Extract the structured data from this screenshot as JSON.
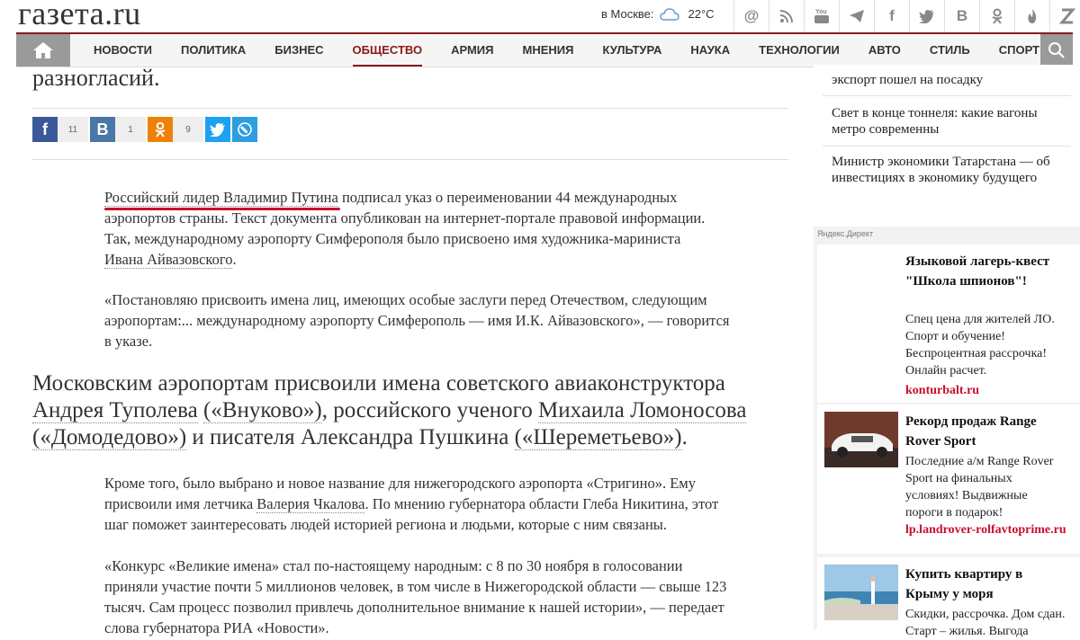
{
  "site": {
    "logo": "газета.ru"
  },
  "weather": {
    "label": "в Москве:",
    "temp": "22°C"
  },
  "social_top": [
    "at-icon",
    "rss-icon",
    "youtube-icon",
    "telegram-icon",
    "facebook-icon",
    "twitter-icon",
    "vk-icon",
    "odnoklassniki-icon",
    "fire-icon",
    "zen-icon"
  ],
  "nav": {
    "items": [
      "НОВОСТИ",
      "ПОЛИТИКА",
      "БИЗНЕС",
      "ОБЩЕСТВО",
      "АРМИЯ",
      "МНЕНИЯ",
      "КУЛЬТУРА",
      "НАУКА",
      "ТЕХНОЛОГИИ",
      "АВТО",
      "СТИЛЬ",
      "СПОРТ"
    ],
    "active": "ОБЩЕСТВО"
  },
  "article": {
    "prev_heading": "разногласий.",
    "share": {
      "fb_count": "11",
      "vk_count": "1",
      "ok_count": "9"
    },
    "p1": {
      "link": "Российский лидер Владимир Путина",
      "line1_rest": " подписал указ о переименовании 44 международных",
      "line2": "аэропортов страны. Текст документа опубликован на интернет-портале правовой информации.",
      "line3": "Так, международному аэропорту Симферополя было присвоено имя художника-мариниста",
      "line4_link": "Ивана Айвазовского",
      "line4_end": "."
    },
    "p2": {
      "line1": "«Постановляю присвоить имена лиц, имеющих особые заслуги перед Отечеством, следующим",
      "line2": "аэропортам:... международному аэропорту Симферополь — имя И.К. Айвазовского», — говорится",
      "line3": "в указе."
    },
    "subhead": {
      "l1": "Московским аэропортам присвоили имена советского авиаконструктора",
      "l2_link1": "Андрея Туполева",
      "l2_mid1": " ",
      "l2_link2": "(«Внуково»)",
      "l2_mid2": ", российского ученого ",
      "l2_link3": "Михаила Ломоносова",
      "l3_link1": "(«Домодедово»)",
      "l3_mid": " и писателя Александра Пушкина ",
      "l3_link2": "(«Шереметьево»)",
      "l3_end": "."
    },
    "p3": {
      "line1": "Кроме того, было выбрано и новое название для нижегородского аэропорта «Стригино». Ему",
      "line2_start": "присвоили имя летчика ",
      "line2_link": "Валерия Чкалова",
      "line2_end": ". По мнению губернатора области Глеба Никитина, этот",
      "line3": "шаг поможет заинтересовать людей историей региона и людьми, которые с ним связаны."
    },
    "p4": {
      "line1": "«Конкурс «Великие имена» стал по-настоящему народным: с 8 по 30 ноября в голосовании",
      "line2": "приняли участие почти 5 миллионов человек, в том числе в Нижегородской области — свыше 123",
      "line3": "тысяч. Сам процесс позволил привлечь дополнительное внимание к нашей истории», — передает",
      "line4": "слова губернатора РИА «Новости»."
    }
  },
  "sidebar": {
    "news": [
      "экспорт пошел на посадку",
      "Свет в конце тоннеля: какие вагоны метро современны",
      "Министр экономики Татарстана — об инвестициях в экономику будущего"
    ],
    "direct_label": "Яндекс.Директ",
    "ads": [
      {
        "title": "Языковой лагерь-квест \"Школа шпионов\"!",
        "text": "Спец цена для жителей ЛО. Спорт и обучение! Беспроцентная рассрочка! Онлайн расчет.",
        "domain": "konturbalt.ru"
      },
      {
        "title": "Рекорд продаж Range Rover Sport",
        "text": "Последние а/м Range Rover Sport на финальных условиях! Выдвижные пороги в подарок!",
        "domain": "lp.landrover-rolfavtoprime.ru"
      },
      {
        "title": "Купить квартиру в Крыму у моря",
        "text": "Скидки, рассрочка. Дом сдан. Старт – жилья. Выгода"
      }
    ]
  },
  "colors": {
    "brand": "#8b1a1a",
    "underline": "#c8102e",
    "fb": "#3b5998",
    "vk": "#4a76a8",
    "ok": "#ee8208",
    "tw": "#1da1f2",
    "lj": "#2d9ee0"
  }
}
